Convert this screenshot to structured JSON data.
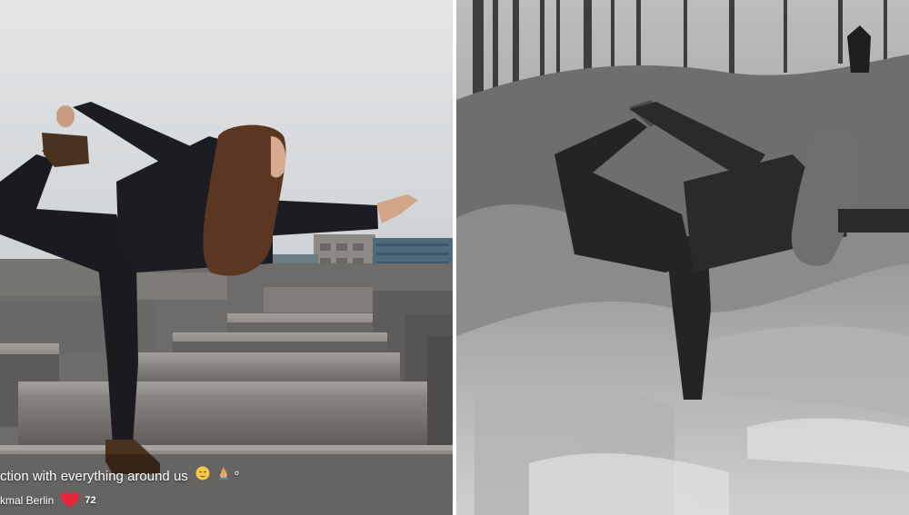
{
  "left_photo": {
    "caption": {
      "text": "ction with everything around us",
      "trailing_mark": "°",
      "emojis": [
        "relieved-face-icon",
        "folded-hands-icon"
      ],
      "location": "kmal Berlin",
      "like_count": "72"
    },
    "colors": {
      "sky": "#d9dcde",
      "concrete": "#6f6d6b",
      "heart": "#e8253a"
    }
  },
  "right_photo": {
    "grayscale": true
  }
}
